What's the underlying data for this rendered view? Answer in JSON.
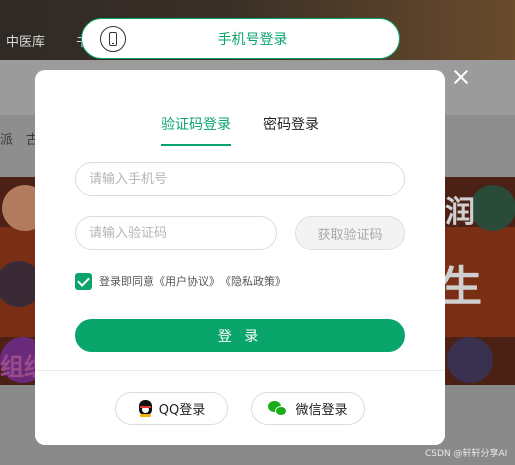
{
  "background": {
    "nav_items": [
      "中医库",
      "书"
    ],
    "side_tags": [
      "派",
      "古"
    ],
    "banner_text": [
      "润",
      "生",
      "组织"
    ]
  },
  "top_pill": {
    "label": "手机号登录",
    "icon": "phone-icon"
  },
  "modal": {
    "tabs": [
      {
        "label": "验证码登录",
        "active": true
      },
      {
        "label": "密码登录",
        "active": false
      }
    ],
    "phone_input": {
      "value": "",
      "placeholder": "请输入手机号"
    },
    "code_input": {
      "value": "",
      "placeholder": "请输入验证码"
    },
    "get_code_label": "获取验证码",
    "agreement": {
      "checked": true,
      "prefix": "登录即同意",
      "user_agreement": "《用户协议》",
      "privacy_policy": "《隐私政策》"
    },
    "login_label": "登 录",
    "social": [
      {
        "label": "QQ登录",
        "icon": "qq-icon"
      },
      {
        "label": "微信登录",
        "icon": "wechat-icon"
      }
    ]
  },
  "colors": {
    "accent": "#0aa56b",
    "qq_black": "#111111",
    "wechat_green": "#1aad19"
  },
  "watermark": "CSDN @轩轩分享AI"
}
